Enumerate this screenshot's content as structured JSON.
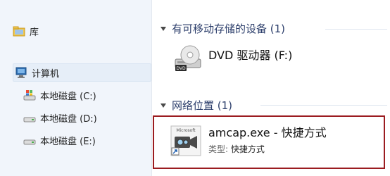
{
  "nav": {
    "items": [
      {
        "label": "库",
        "icon": "library-icon"
      },
      {
        "label": "计算机",
        "icon": "computer-icon"
      },
      {
        "label": "本地磁盘 (C:)",
        "icon": "windows-drive-icon"
      },
      {
        "label": "本地磁盘 (D:)",
        "icon": "drive-icon"
      },
      {
        "label": "本地磁盘 (E:)",
        "icon": "drive-icon"
      }
    ]
  },
  "content": {
    "removable_group": {
      "header": "有可移动存储的设备 (1)",
      "items": [
        {
          "title": "DVD 驱动器 (F:)",
          "icon": "dvd-drive-icon"
        }
      ]
    },
    "network_group": {
      "header": "网络位置 (1)",
      "items": [
        {
          "title": "amcap.exe - 快捷方式",
          "type_label": "类型:",
          "type_value": "快捷方式",
          "icon": "amcap-shortcut-icon"
        }
      ]
    }
  },
  "colors": {
    "nav_bg": "#f1f5fb",
    "highlight_border": "#9b1c20",
    "group_header": "#2c3e6b"
  }
}
